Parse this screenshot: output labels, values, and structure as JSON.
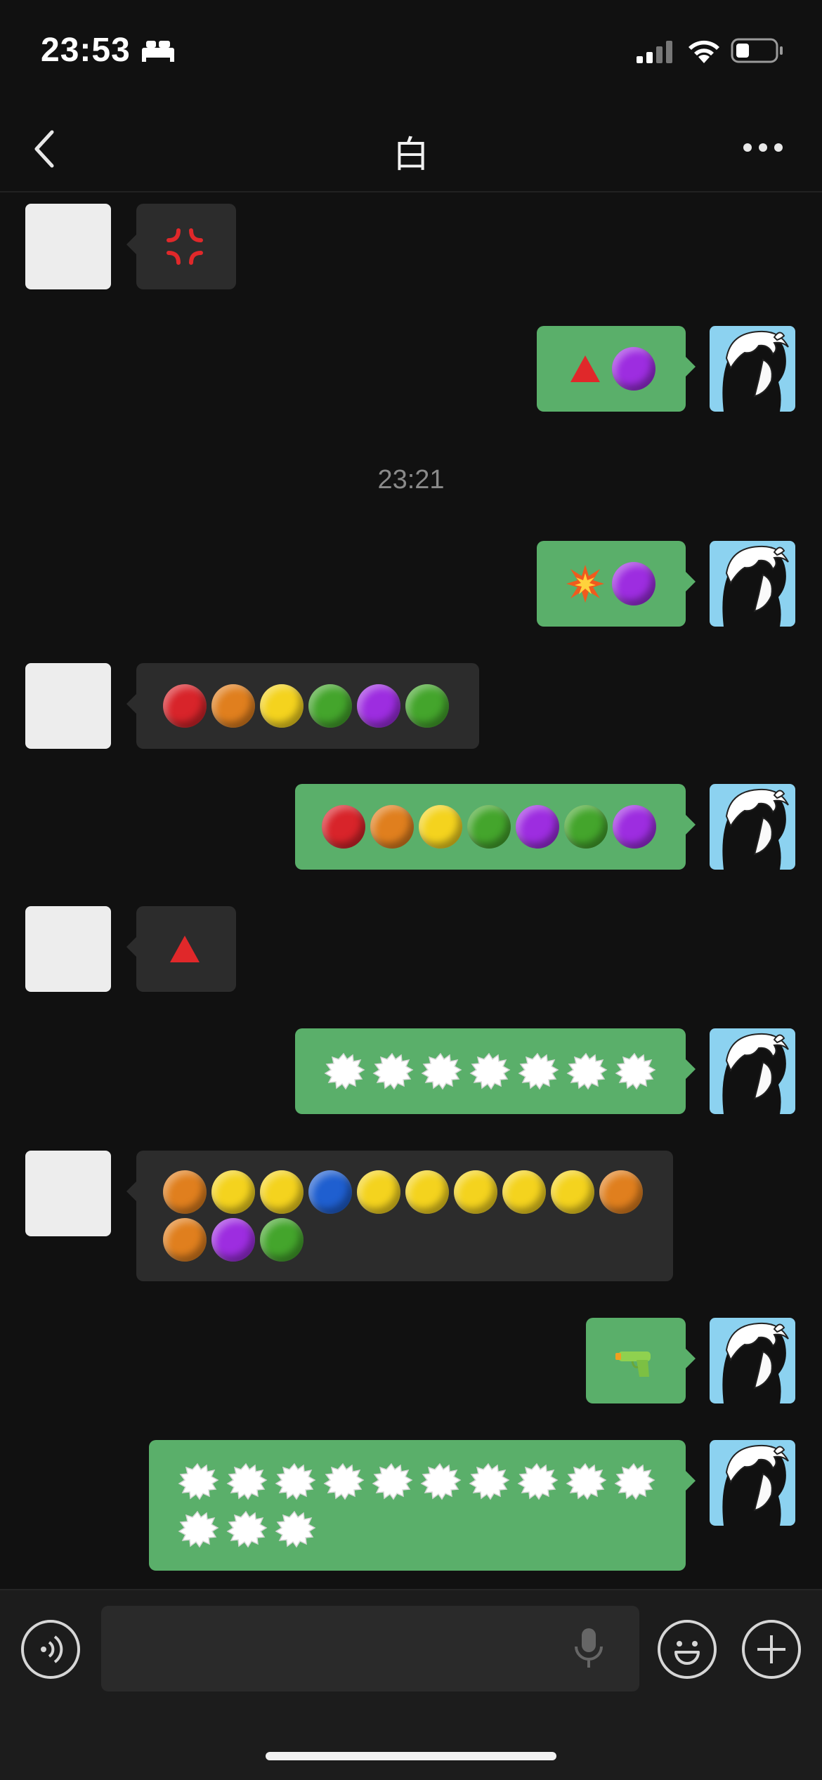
{
  "status_bar": {
    "time": "23:53",
    "icons": [
      "bed-icon",
      "cellular-signal-icon",
      "wifi-icon",
      "battery-icon"
    ]
  },
  "nav": {
    "title": "白",
    "back_icon": "chevron-left-icon",
    "more_icon": "more-dots-icon"
  },
  "timestamp": "23:21",
  "messages": [
    {
      "side": "in",
      "emojis": [
        "anger"
      ]
    },
    {
      "side": "out",
      "emojis": [
        "red-triangle",
        "purple"
      ]
    },
    {
      "side": "out",
      "emojis": [
        "collision",
        "purple"
      ]
    },
    {
      "side": "in",
      "emojis": [
        "red",
        "orange",
        "yellow",
        "green",
        "purple",
        "green"
      ]
    },
    {
      "side": "out",
      "emojis": [
        "red",
        "orange",
        "yellow",
        "green",
        "purple",
        "green",
        "purple"
      ]
    },
    {
      "side": "in",
      "emojis": [
        "red-triangle"
      ]
    },
    {
      "side": "out",
      "emojis": [
        "speech-balloon",
        "speech-balloon",
        "speech-balloon",
        "speech-balloon",
        "speech-balloon",
        "speech-balloon",
        "speech-balloon"
      ]
    },
    {
      "side": "in",
      "emojis": [
        "orange",
        "yellow",
        "yellow",
        "blue",
        "yellow",
        "yellow",
        "yellow",
        "yellow",
        "yellow",
        "orange",
        "orange",
        "purple",
        "green"
      ]
    },
    {
      "side": "out",
      "emojis": [
        "water-pistol"
      ]
    },
    {
      "side": "out",
      "emojis": [
        "speech-balloon",
        "speech-balloon",
        "speech-balloon",
        "speech-balloon",
        "speech-balloon",
        "speech-balloon",
        "speech-balloon",
        "speech-balloon",
        "speech-balloon",
        "speech-balloon",
        "speech-balloon",
        "speech-balloon",
        "speech-balloon"
      ]
    }
  ],
  "input_bar": {
    "placeholder": "",
    "icons": [
      "voice-icon",
      "mic-icon",
      "emoji-icon",
      "plus-icon"
    ]
  },
  "colors": {
    "background": "#111111",
    "outgoing_bubble": "#5aaf6a",
    "incoming_bubble": "#2c2c2c",
    "avatar_blue": "#8cd2f0"
  }
}
